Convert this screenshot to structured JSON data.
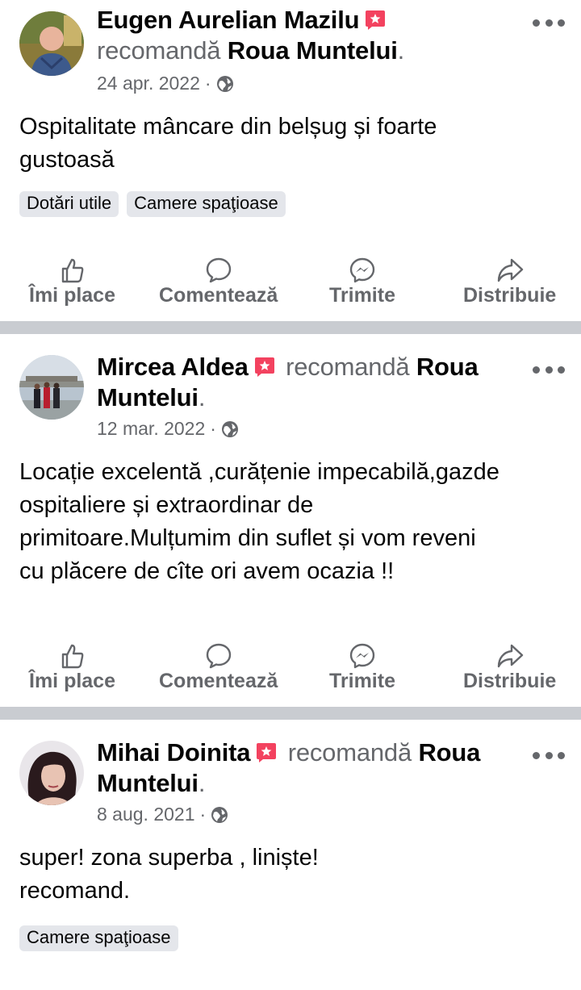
{
  "posts": [
    {
      "author": "Eugen Aurelian Mazilu",
      "verb": "recomandă",
      "page": "Roua Muntelui",
      "date": "24 apr. 2022",
      "separator": "·",
      "text_lines": [
        "Ospitalitate mâncare din belșug și foarte",
        "gustoasă"
      ],
      "tags": [
        "Dotări utile",
        "Camere spaţioase"
      ]
    },
    {
      "author": "Mircea Aldea",
      "verb": "recomandă",
      "page": "Roua",
      "page_line2": "Muntelui",
      "date": "12 mar. 2022",
      "separator": "·",
      "text_lines": [
        "Locație excelentă ,curățenie impecabilă,gazde",
        "ospitaliere și extraordinar de",
        "primitoare.Mulțumim din suflet și vom reveni",
        "cu plăcere de cîte ori avem ocazia !!"
      ]
    },
    {
      "author": "Mihai Doinita",
      "verb": "recomandă",
      "page": "Roua",
      "page_line2": "Muntelui",
      "date": "8 aug. 2021",
      "separator": "·",
      "text_lines": [
        "super! zona superba , liniște!",
        "recomand."
      ],
      "tags": [
        "Camere spaţioase"
      ]
    }
  ],
  "actions": {
    "like": "Îmi place",
    "comment": "Comentează",
    "send": "Trimite",
    "share": "Distribuie"
  },
  "period": ".",
  "icons": {
    "badge": "recommend-badge-icon",
    "audience": "globe-icon",
    "more": "more-options-icon",
    "like": "thumbs-up-icon",
    "comment": "comment-bubble-icon",
    "send": "messenger-icon",
    "share": "share-arrow-icon"
  },
  "colors": {
    "badge": "#f3425f",
    "secondary_text": "#65676b",
    "divider": "#c9ccd1",
    "tag_bg": "#e4e6eb"
  }
}
